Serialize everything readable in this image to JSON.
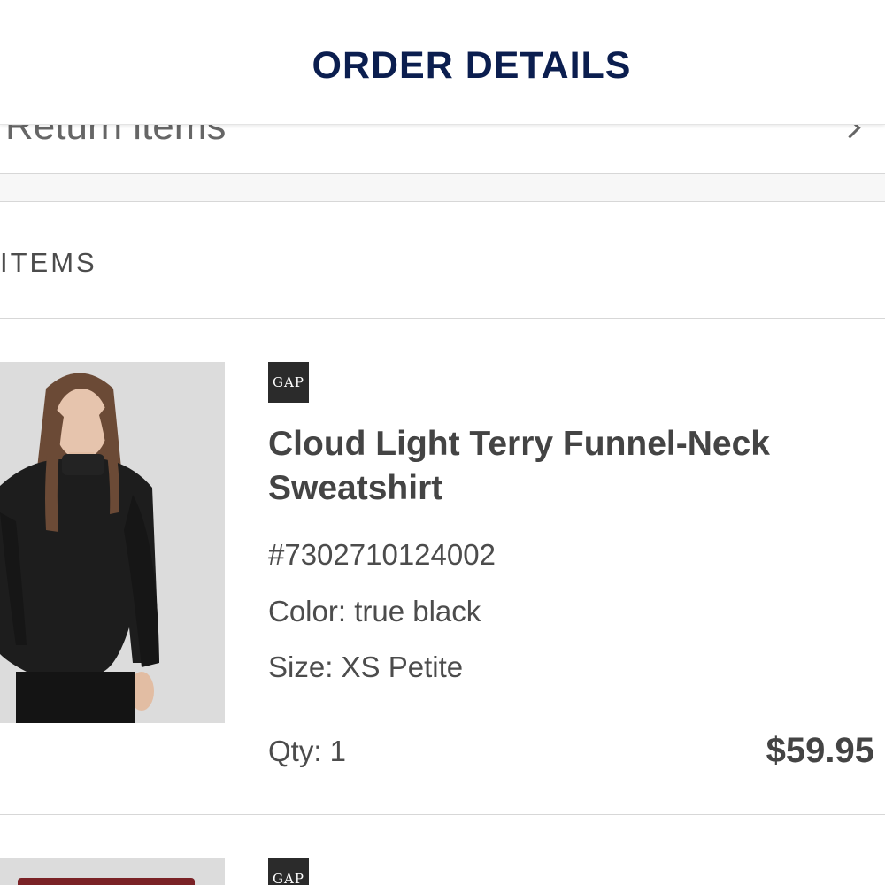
{
  "header": {
    "title": "ORDER DETAILS"
  },
  "return_row": {
    "label": "Return items"
  },
  "items_section": {
    "heading": "ITEMS"
  },
  "items": [
    {
      "brand": "GAP",
      "name": "Cloud Light Terry Funnel-Neck Sweatshirt",
      "sku": "#7302710124002",
      "color": "Color: true black",
      "size": "Size: XS Petite",
      "qty": "Qty: 1",
      "price": "$59.95"
    },
    {
      "brand": "GAP"
    }
  ]
}
